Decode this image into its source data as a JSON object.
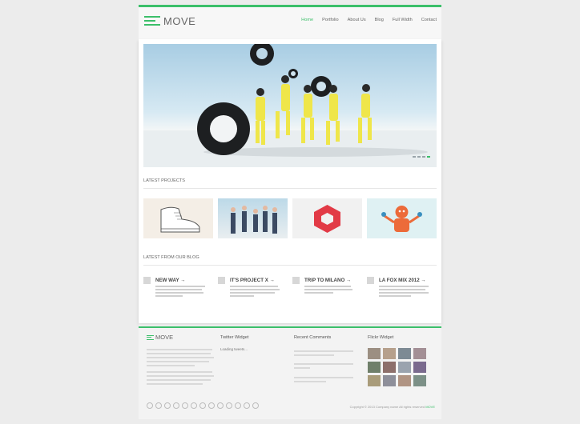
{
  "brand": {
    "name": "MOVE",
    "accent": "#3cbf6a"
  },
  "nav": [
    "Home",
    "Portfolio",
    "About Us",
    "Blog",
    "Full Width",
    "Contact"
  ],
  "sections": {
    "latest_projects": "LATEST PROJECTS",
    "latest_blog": "LATEST FROM OUR BLOG"
  },
  "posts": [
    {
      "title": "NEW WAY →",
      "icon": "document-icon"
    },
    {
      "title": "IT'S PROJECT X →",
      "icon": "document-icon"
    },
    {
      "title": "TRIP TO MILANO →",
      "icon": "document-icon"
    },
    {
      "title": "LA FOX MIX 2012 →",
      "icon": "document-icon"
    }
  ],
  "footer": {
    "logo": "MOVE",
    "twitter_title": "Twitter Widget",
    "twitter_loading": "Loading tweets...",
    "comments_title": "Recent Comments",
    "flickr_title": "Flickr Widget",
    "copyright_prefix": "Copyright © 2013 Company name All rights reserved",
    "copyright_brand": "MOVE"
  }
}
